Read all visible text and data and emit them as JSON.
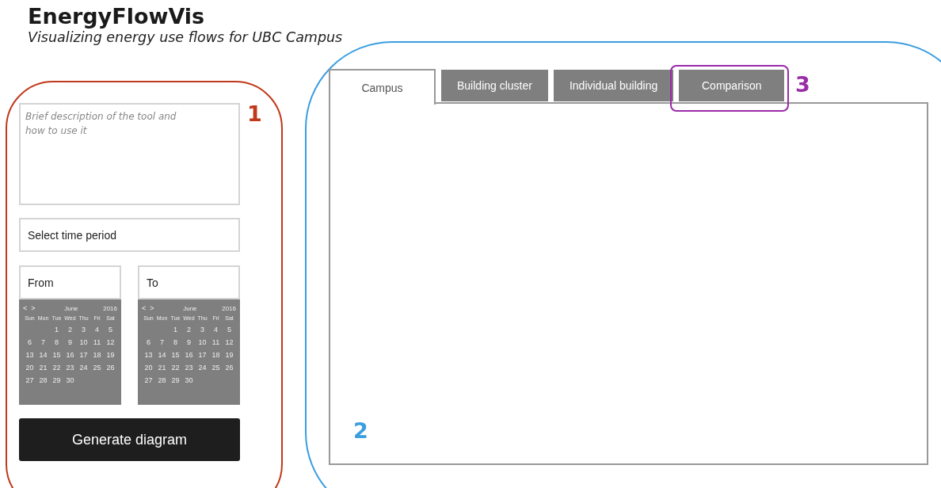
{
  "header": {
    "title": "EnergyFlowVis",
    "subtitle": "Visualizing energy use flows for UBC Campus"
  },
  "controls": {
    "description": {
      "placeholder": "Brief description of the tool and how to use it"
    },
    "time_period": {
      "placeholder": "Select time period"
    },
    "dates": [
      {
        "placeholder": "From",
        "calendar": {
          "nav": [
            "<",
            ">"
          ],
          "month": "June",
          "year": "2016",
          "weekdays": [
            "Sun",
            "Mon",
            "Tue",
            "Wed",
            "Thu",
            "Fri",
            "Sat"
          ],
          "weeks": [
            [
              "1",
              "2",
              "3",
              "4",
              "5"
            ],
            [
              "6",
              "7",
              "8",
              "9",
              "10",
              "11",
              "12"
            ],
            [
              "13",
              "14",
              "15",
              "16",
              "17",
              "18",
              "19"
            ],
            [
              "20",
              "21",
              "22",
              "23",
              "24",
              "25",
              "26"
            ],
            [
              "27",
              "28",
              "29",
              "30"
            ]
          ]
        }
      },
      {
        "placeholder": "To",
        "calendar": {
          "nav": [
            "<",
            ">"
          ],
          "month": "June",
          "year": "2016",
          "weekdays": [
            "Sun",
            "Mon",
            "Tue",
            "Wed",
            "Thu",
            "Fri",
            "Sat"
          ],
          "weeks": [
            [
              "1",
              "2",
              "3",
              "4",
              "5"
            ],
            [
              "6",
              "7",
              "8",
              "9",
              "10",
              "11",
              "12"
            ],
            [
              "13",
              "14",
              "15",
              "16",
              "17",
              "18",
              "19"
            ],
            [
              "20",
              "21",
              "22",
              "23",
              "24",
              "25",
              "26"
            ],
            [
              "27",
              "28",
              "29",
              "30"
            ]
          ]
        }
      }
    ],
    "button": "Generate diagram"
  },
  "tabs": [
    {
      "label": "Campus",
      "selected": true
    },
    {
      "label": "Building cluster",
      "selected": false
    },
    {
      "label": "Individual building",
      "selected": false
    },
    {
      "label": "Comparison",
      "selected": false
    }
  ],
  "annotations": [
    {
      "label": "1",
      "color": "#c0391b"
    },
    {
      "label": "2",
      "color": "#3a9ee0"
    },
    {
      "label": "3",
      "color": "#9a2aa8"
    }
  ]
}
